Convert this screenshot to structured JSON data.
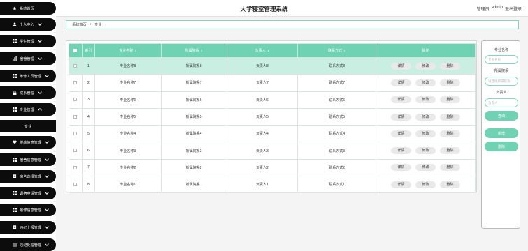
{
  "header": {
    "title": "大学寝室管理系统",
    "user_role": "管理员",
    "user_name": "admin",
    "logout": "退出登录"
  },
  "sidebar": {
    "items": [
      {
        "label": "系统首页",
        "icon": "home-icon",
        "expandable": false
      },
      {
        "label": "个人中心",
        "icon": "user-icon",
        "expandable": true
      },
      {
        "label": "学生管理",
        "icon": "grid-icon",
        "expandable": true
      },
      {
        "label": "宿管管理",
        "icon": "bar-chart-icon",
        "expandable": true
      },
      {
        "label": "维修人员管理",
        "icon": "grid-icon",
        "expandable": true
      },
      {
        "label": "院系管理",
        "icon": "lock-icon",
        "expandable": true
      },
      {
        "label": "专业管理",
        "icon": "grid-icon",
        "expandable": true,
        "expanded": true
      },
      {
        "label": "楼栋信息管理",
        "icon": "heart-icon",
        "expandable": true
      },
      {
        "label": "宿舍信息管理",
        "icon": "grid-icon",
        "expandable": true
      },
      {
        "label": "宿舍选择管理",
        "icon": "document-icon",
        "expandable": true
      },
      {
        "label": "调宿申请管理",
        "icon": "grid-icon",
        "expandable": true
      },
      {
        "label": "报修信息管理",
        "icon": "grid-icon",
        "expandable": true
      },
      {
        "label": "违纪上报管理",
        "icon": "document-icon",
        "expandable": true
      },
      {
        "label": "违纪处理管理",
        "icon": "menu-icon",
        "expandable": true
      }
    ],
    "sub_item": "专业"
  },
  "breadcrumb": {
    "home": "系统首页",
    "separator": "⋮",
    "current": "专业"
  },
  "table": {
    "headers": {
      "index": "索引",
      "name": "专业名称",
      "dept": "所属院系",
      "leader": "负责人",
      "contact": "联系方式",
      "ops": "操作"
    },
    "buttons": {
      "detail": "详情",
      "edit": "修改",
      "delete": "删除"
    },
    "rows": [
      {
        "index": "1",
        "name": "专业名称8",
        "dept": "所属院系8",
        "leader": "负责人8",
        "contact": "联系方式8"
      },
      {
        "index": "2",
        "name": "专业名称7",
        "dept": "所属院系7",
        "leader": "负责人7",
        "contact": "联系方式7"
      },
      {
        "index": "3",
        "name": "专业名称6",
        "dept": "所属院系6",
        "leader": "负责人6",
        "contact": "联系方式6"
      },
      {
        "index": "4",
        "name": "专业名称5",
        "dept": "所属院系5",
        "leader": "负责人5",
        "contact": "联系方式5"
      },
      {
        "index": "5",
        "name": "专业名称4",
        "dept": "所属院系4",
        "leader": "负责人4",
        "contact": "联系方式4"
      },
      {
        "index": "6",
        "name": "专业名称3",
        "dept": "所属院系3",
        "leader": "负责人3",
        "contact": "联系方式3"
      },
      {
        "index": "7",
        "name": "专业名称2",
        "dept": "所属院系2",
        "leader": "负责人2",
        "contact": "联系方式2"
      },
      {
        "index": "8",
        "name": "专业名称1",
        "dept": "所属院系1",
        "leader": "负责人1",
        "contact": "联系方式1"
      }
    ]
  },
  "search": {
    "label_name": "专业名称",
    "placeholder_name": "专业名称",
    "label_dept": "所属院系",
    "placeholder_dept": "请选择所属院系",
    "label_leader": "负责人",
    "placeholder_leader": "负责人",
    "query": "查询",
    "add": "新增",
    "delete": "删除"
  },
  "colors": {
    "accent": "#6fd3b3",
    "sidebar": "#0c0c0c",
    "selected_row": "#c9efe2"
  }
}
